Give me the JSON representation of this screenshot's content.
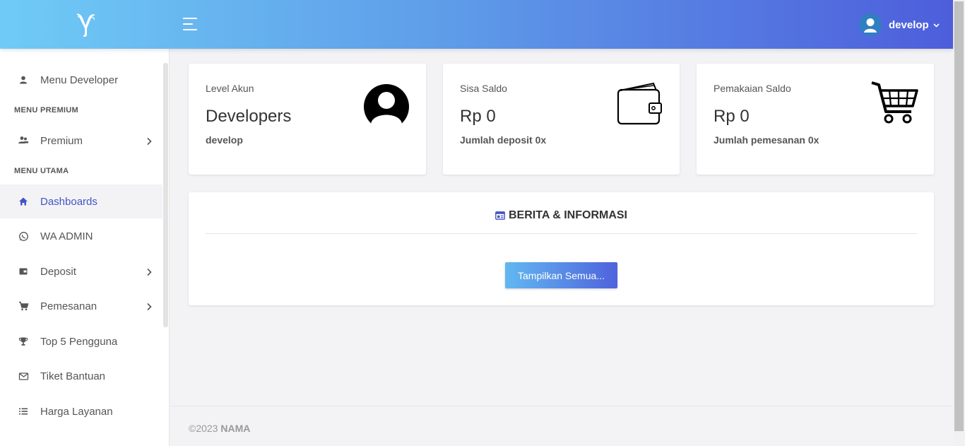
{
  "header": {
    "user": {
      "name": "develop"
    }
  },
  "sidebar": {
    "items": [
      {
        "label": "Menu Developer",
        "icon": "person-icon"
      },
      {
        "label": "Premium",
        "icon": "people-icon"
      },
      {
        "label": "Dashboards",
        "icon": "home-icon"
      },
      {
        "label": "WA ADMIN",
        "icon": "whatsapp-icon"
      },
      {
        "label": "Deposit",
        "icon": "wallet-icon"
      },
      {
        "label": "Pemesanan",
        "icon": "cart-icon"
      },
      {
        "label": "Top 5 Pengguna",
        "icon": "trophy-icon"
      },
      {
        "label": "Tiket Bantuan",
        "icon": "envelope-icon"
      },
      {
        "label": "Harga Layanan",
        "icon": "list-icon"
      }
    ],
    "headings": [
      "MENU PREMIUM",
      "MENU UTAMA"
    ]
  },
  "cards": [
    {
      "label": "Level Akun",
      "value": "Developers",
      "sub": "develop",
      "icon": "user-circle-icon"
    },
    {
      "label": "Sisa Saldo",
      "value": "Rp 0",
      "sub": "Jumlah deposit 0x",
      "icon": "wallet-icon"
    },
    {
      "label": "Pemakaian Saldo",
      "value": "Rp 0",
      "sub": "Jumlah pemesanan 0x",
      "icon": "shopping-cart-icon"
    }
  ],
  "news": {
    "title": "BERITA & INFORMASI",
    "button_label": "Tampilkan Semua..."
  },
  "footer": {
    "copyright": "©2023",
    "brand": "NAMA"
  },
  "colors": {
    "header_gradient_start": "#6fcbf6",
    "header_gradient_end": "#4d5edb",
    "active_text": "#4454c3",
    "page_background": "#f3f3f6"
  }
}
